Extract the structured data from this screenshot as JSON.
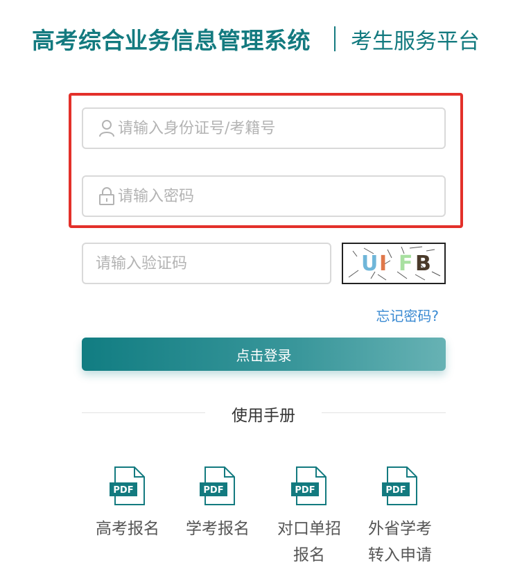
{
  "header": {
    "system_title": "高考综合业务信息管理系统",
    "platform_title": "考生服务平台"
  },
  "login_form": {
    "id_placeholder": "请输入身份证号/考籍号",
    "password_placeholder": "请输入密码",
    "captcha_placeholder": "请输入验证码",
    "captcha_text": [
      "U",
      "I",
      "F",
      "B"
    ],
    "forgot_password": "忘记密码?",
    "login_button": "点击登录"
  },
  "manuals": {
    "title": "使用手册",
    "pdf_badge": "PDF",
    "items": [
      {
        "label": "高考报名"
      },
      {
        "label": "学考报名"
      },
      {
        "label": "对口单招报名"
      },
      {
        "label": "外省学考转入申请"
      }
    ]
  },
  "colors": {
    "brand": "#137a7f",
    "highlight": "#e3302a",
    "link": "#3a8ad2"
  }
}
